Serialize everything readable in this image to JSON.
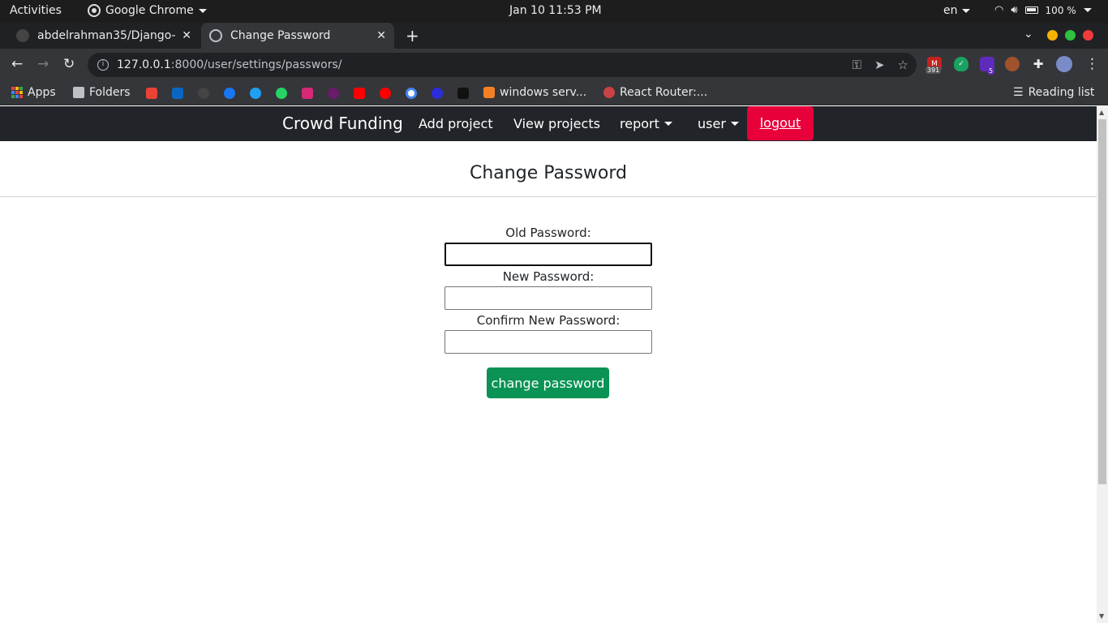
{
  "system_bar": {
    "activities": "Activities",
    "app_name": "Google Chrome",
    "clock": "Jan 10  11:53 PM",
    "language": "en",
    "battery": "100 %"
  },
  "tabs": [
    {
      "title": "abdelrahman35/Django-p",
      "close": "✕"
    },
    {
      "title": "Change Password",
      "close": "✕"
    }
  ],
  "toolbar": {
    "url_host": "127.0.0.1",
    "url_rest": ":8000/user/settings/passwors/",
    "gmail_badge": "391",
    "ext_badge": "5"
  },
  "bookmarks": [
    {
      "label": "Apps"
    },
    {
      "label": "Folders"
    },
    {
      "label": "windows serv..."
    },
    {
      "label": "React Router:..."
    }
  ],
  "reading_list": "Reading list",
  "nav": {
    "brand": "Crowd Funding",
    "add_project": "Add project",
    "view_projects": "View projects",
    "report": "report",
    "user": "user",
    "logout": "logout"
  },
  "form": {
    "title": "Change Password",
    "old_password_label": "Old Password:",
    "new_password_label": "New Password:",
    "confirm_password_label": "Confirm New Password:",
    "old_password_value": "",
    "new_password_value": "",
    "confirm_password_value": "",
    "submit_label": "change password"
  },
  "colors": {
    "logout_bg": "#e8003a",
    "submit_bg": "#0a9354",
    "navbar_bg": "#212529"
  }
}
